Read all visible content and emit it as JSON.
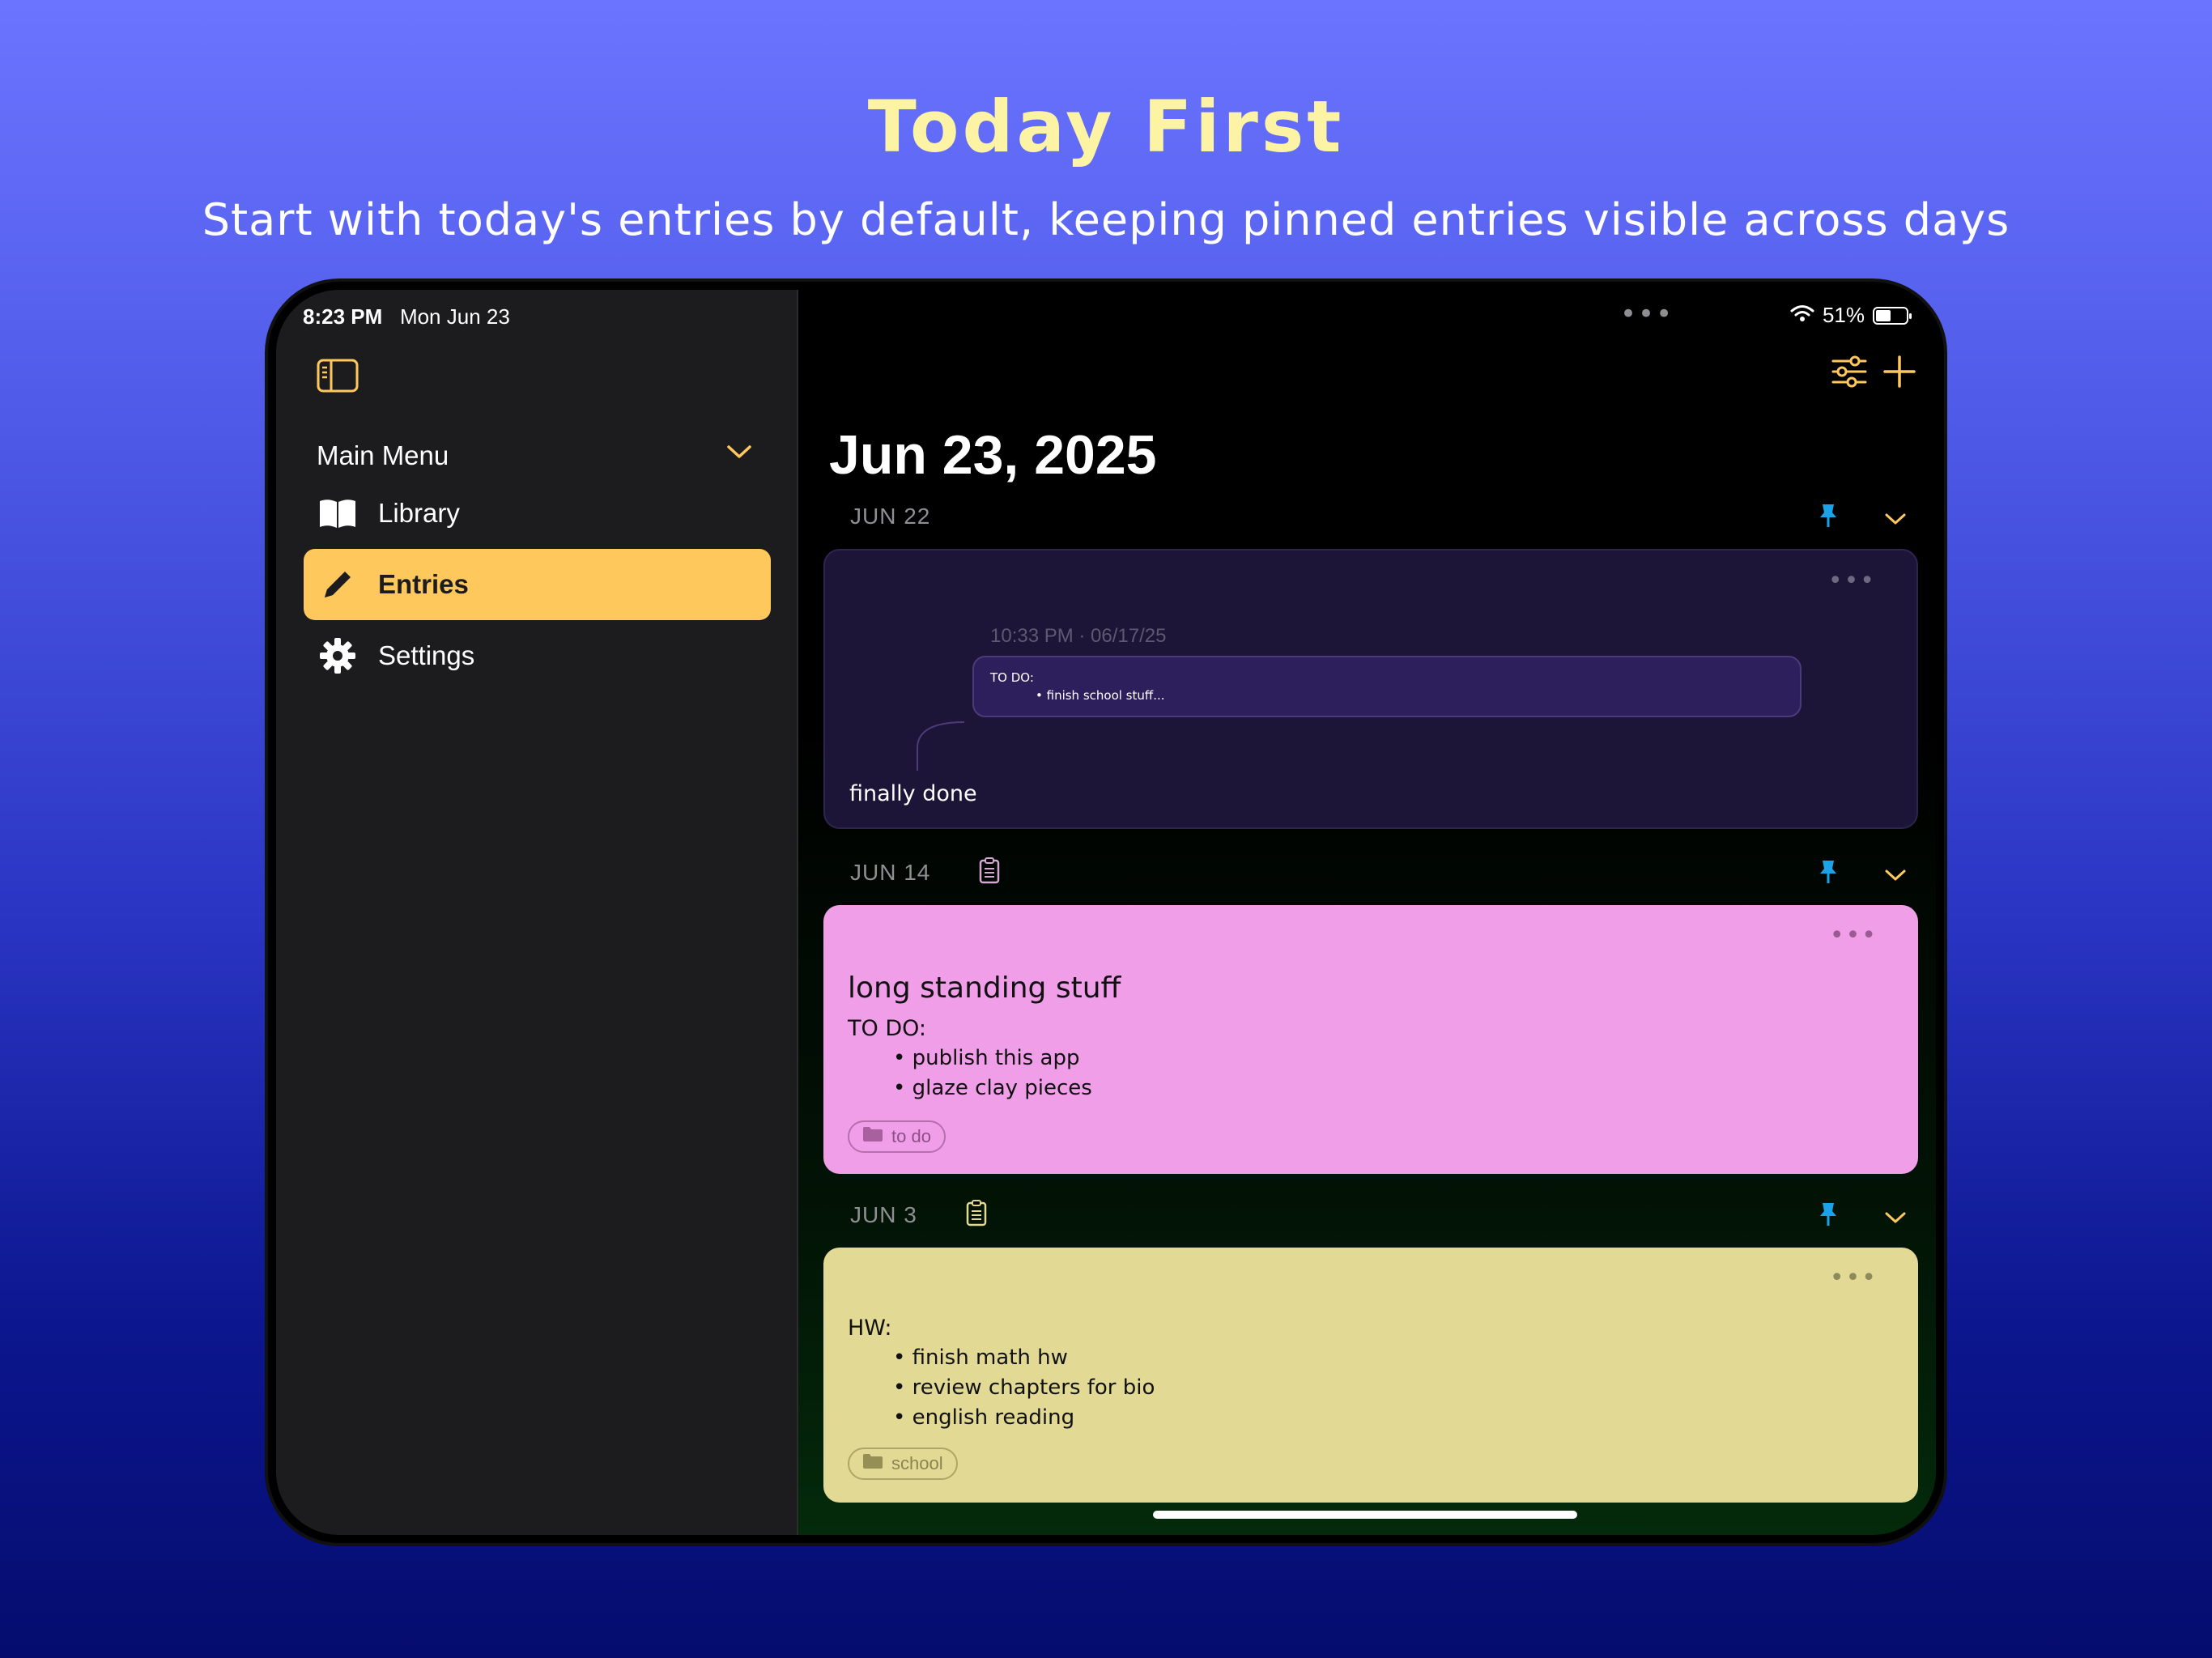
{
  "promo": {
    "headline": "Today First",
    "subline": "Start with today's entries by default, keeping pinned entries visible across days"
  },
  "status_bar": {
    "time": "8:23 PM",
    "date": "Mon Jun 23",
    "battery": "51%"
  },
  "sidebar": {
    "section_title": "Main Menu",
    "items": [
      {
        "label": "Library",
        "icon": "book-icon",
        "active": false
      },
      {
        "label": "Entries",
        "icon": "pencil-icon",
        "active": true
      },
      {
        "label": "Settings",
        "icon": "gear-icon",
        "active": false
      }
    ]
  },
  "main": {
    "title": "Jun 23, 2025",
    "days": [
      {
        "date": "JUN 22",
        "pinned": true,
        "card": {
          "color": "#1d1538",
          "reply_meta": "10:33 PM · 06/17/25",
          "reply_line1": "TO DO:",
          "reply_line2": "• finish school stuff...",
          "text": "finally done"
        }
      },
      {
        "date": "JUN 14",
        "pinned": true,
        "card": {
          "color": "#f19ee9",
          "title": "long standing stuff",
          "heading": "TO DO:",
          "bullets": [
            "• publish this app",
            "• glaze clay pieces"
          ],
          "tag": "to do"
        }
      },
      {
        "date": "JUN 3",
        "pinned": true,
        "card": {
          "color": "#e2d994",
          "heading": "HW:",
          "bullets": [
            "• finish math hw",
            "• review chapters for bio",
            "• english reading"
          ],
          "tag": "school"
        }
      }
    ]
  },
  "colors": {
    "accent": "#ffc85c",
    "pin": "#1aa3e8"
  }
}
